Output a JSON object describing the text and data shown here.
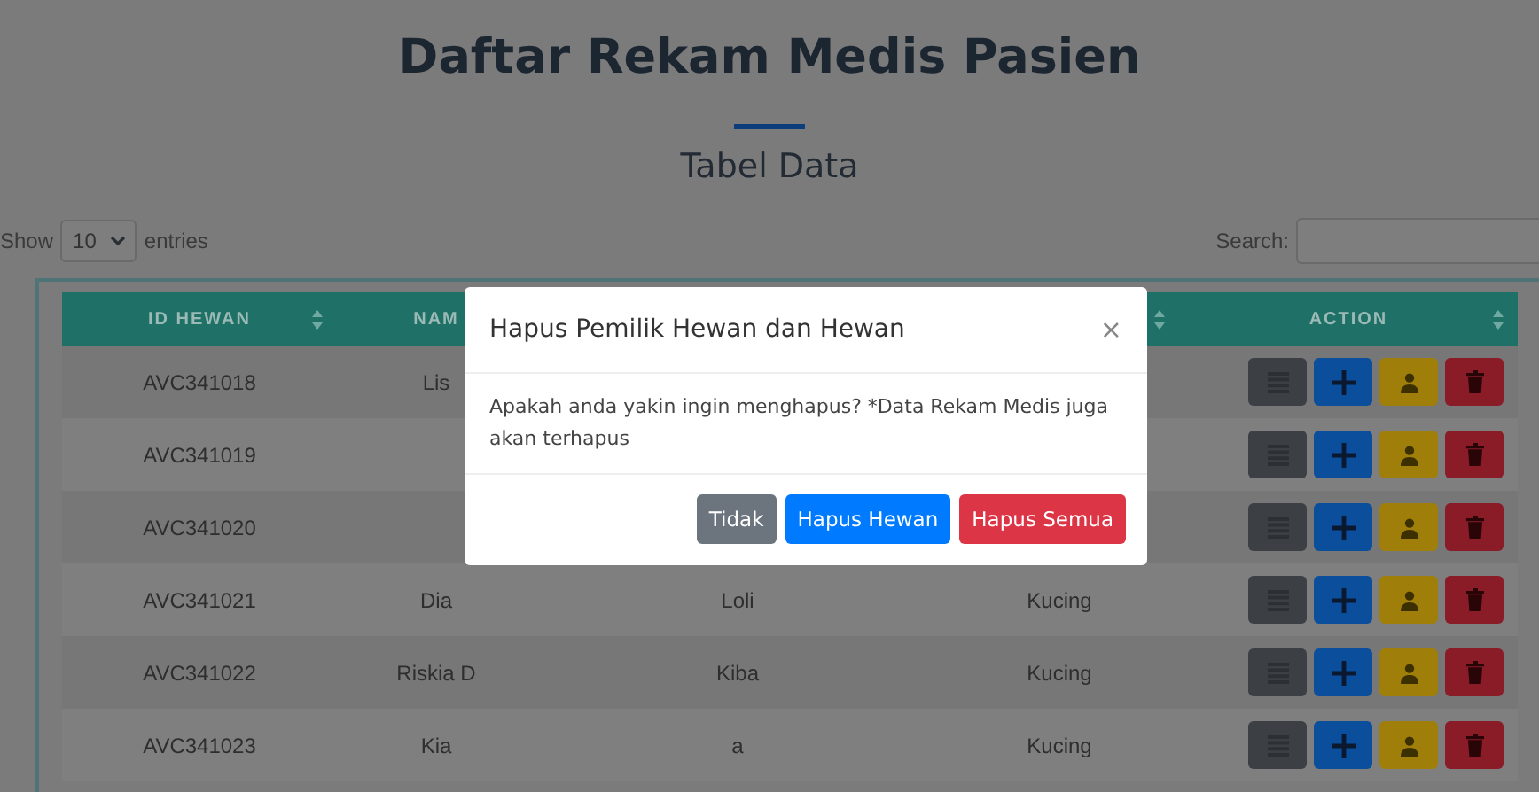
{
  "page": {
    "title": "Daftar Rekam Medis Pasien",
    "subtitle": "Tabel Data"
  },
  "length_control": {
    "before": "Show",
    "value": "10",
    "after": "entries"
  },
  "search": {
    "label": "Search:"
  },
  "table": {
    "columns": [
      {
        "label": "ID HEWAN"
      },
      {
        "label": "NAM"
      },
      {},
      {},
      {
        "label": "ACTION"
      }
    ],
    "rows": [
      {
        "id": "AVC341018",
        "column_2": "Lis"
      },
      {
        "id": "AVC341019"
      },
      {
        "id": "AVC341020"
      },
      {
        "id": "AVC341021",
        "column_2": "Dia",
        "column_3": "Loli",
        "column_4": "Kucing"
      },
      {
        "id": "AVC341022",
        "column_2": "Riskia D",
        "column_3": "Kiba",
        "column_4": "Kucing"
      },
      {
        "id": "AVC341023",
        "column_2": "Kia",
        "column_3": "a",
        "column_4": "Kucing"
      }
    ]
  },
  "modal": {
    "title": "Hapus Pemilik Hewan dan Hewan",
    "close": "×",
    "body": "Apakah anda yakin ingin menghapus? *Data Rekam Medis juga akan terhapus",
    "buttons": [
      {
        "label": "Tidak",
        "kind": "secondary"
      },
      {
        "label": "Hapus Hewan",
        "kind": "primary"
      },
      {
        "label": "Hapus Semua",
        "kind": "danger"
      }
    ]
  }
}
